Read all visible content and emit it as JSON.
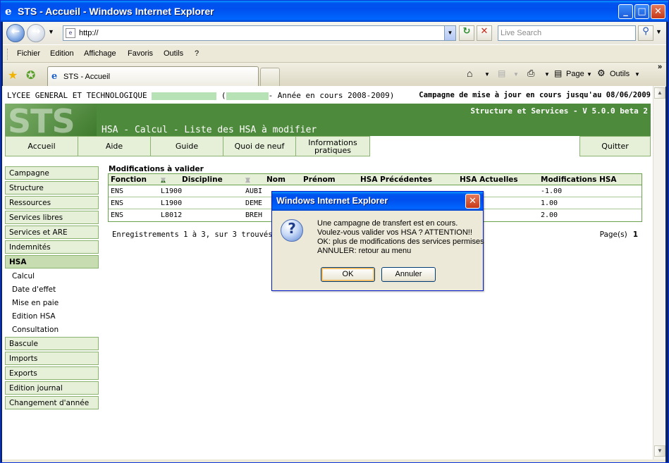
{
  "window": {
    "title": "STS - Accueil - Windows Internet Explorer",
    "minimize": "_",
    "maximize": "□",
    "close": "✕"
  },
  "address": {
    "url": "http://",
    "search_placeholder": "Live Search"
  },
  "menu": [
    "Fichier",
    "Edition",
    "Affichage",
    "Favoris",
    "Outils",
    "?"
  ],
  "tab": {
    "label": "STS - Accueil"
  },
  "commands": {
    "page": "Page",
    "tools": "Outils"
  },
  "header": {
    "school": "LYCEE GENERAL ET TECHNOLOGIQUE",
    "year": "- Année en cours 2008-2009)",
    "campaign": "Campagne de mise à jour en cours jusqu'au 08/06/2009",
    "version": "Structure et Services - V 5.0.0 beta 2",
    "logo": "STS",
    "page_title": "HSA - Calcul - Liste des HSA à modifier"
  },
  "topnav": [
    "Accueil",
    "Aide",
    "Guide",
    "Quoi de neuf",
    "Informations pratiques",
    "Quitter"
  ],
  "sidebar": {
    "items_top": [
      "Campagne",
      "Structure",
      "Ressources",
      "Services libres",
      "Services et ARE",
      "Indemnités",
      "HSA"
    ],
    "sub": [
      "Calcul",
      "Date d'effet",
      "Mise en paie",
      "Edition HSA",
      "Consultation"
    ],
    "items_bottom": [
      "Bascule",
      "Imports",
      "Exports",
      "Edition journal",
      "Changement d'année"
    ]
  },
  "table": {
    "section": "Modifications à valider",
    "headers": [
      "Fonction",
      "Discipline",
      "Nom",
      "Prénom",
      "HSA Précédentes",
      "HSA Actuelles",
      "Modifications HSA"
    ],
    "rows": [
      [
        "ENS",
        "L1900",
        "AUBI",
        "-1.00"
      ],
      [
        "ENS",
        "L1900",
        "DEME",
        "1.00"
      ],
      [
        "ENS",
        "L8012",
        "BREH",
        "2.00"
      ]
    ],
    "footer": "Enregistrements 1 à 3, sur 3 trouvés",
    "pages_label": "Page(s)",
    "page": "1"
  },
  "dialog": {
    "title": "Windows Internet Explorer",
    "lines": [
      "Une campagne de transfert est en cours.",
      "Voulez-vous valider vos HSA ? ATTENTION!!",
      "OK: plus de modifications des services permises",
      "ANNULER: retour au menu"
    ],
    "ok": "OK",
    "cancel": "Annuler"
  }
}
